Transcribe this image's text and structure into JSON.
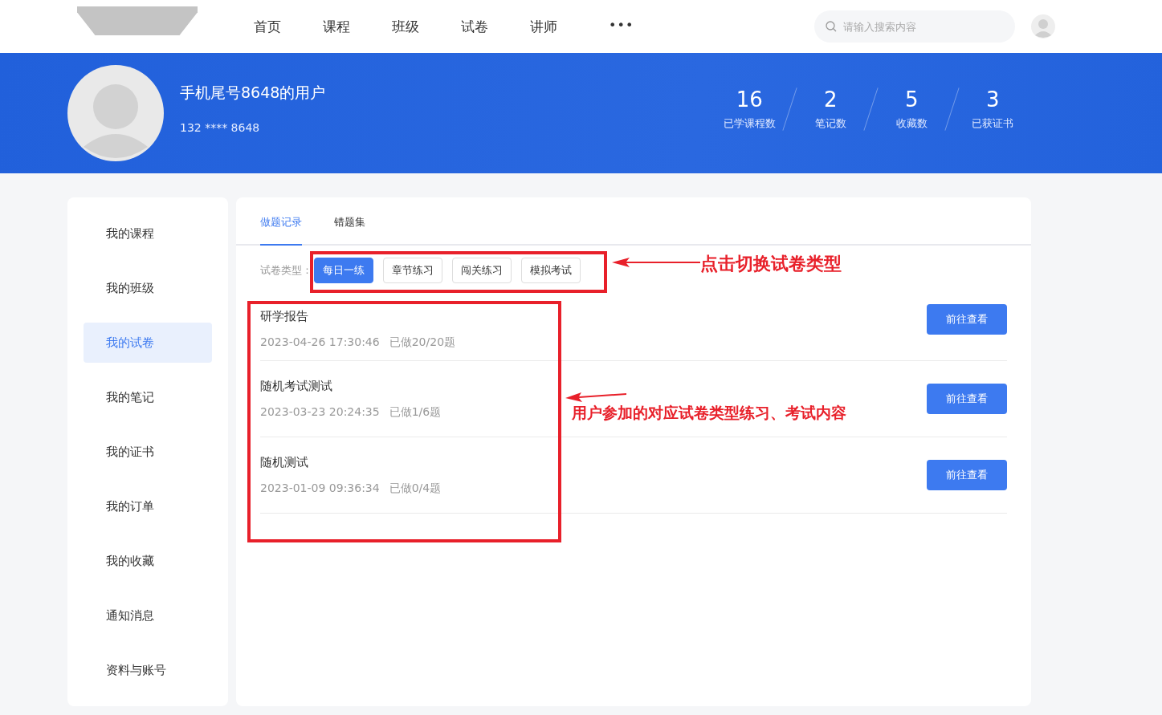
{
  "nav": {
    "items": [
      "首页",
      "课程",
      "班级",
      "试卷",
      "讲师"
    ],
    "more": "•••",
    "search": {
      "placeholder": "请输入搜索内容"
    }
  },
  "profile": {
    "name": "手机尾号8648的用户",
    "phone": "132 **** 8648",
    "stats": [
      {
        "value": "16",
        "label": "已学课程数"
      },
      {
        "value": "2",
        "label": "笔记数"
      },
      {
        "value": "5",
        "label": "收藏数"
      },
      {
        "value": "3",
        "label": "已获证书"
      }
    ]
  },
  "sidebar": {
    "items": [
      {
        "label": "我的课程",
        "selected": false
      },
      {
        "label": "我的班级",
        "selected": false
      },
      {
        "label": "我的试卷",
        "selected": true
      },
      {
        "label": "我的笔记",
        "selected": false
      },
      {
        "label": "我的证书",
        "selected": false
      },
      {
        "label": "我的订单",
        "selected": false
      },
      {
        "label": "我的收藏",
        "selected": false
      },
      {
        "label": "通知消息",
        "selected": false
      },
      {
        "label": "资料与账号",
        "selected": false
      }
    ]
  },
  "tabs": [
    {
      "label": "做题记录",
      "selected": true
    },
    {
      "label": "错题集",
      "selected": false
    }
  ],
  "filter": {
    "label": "试卷类型：",
    "options": [
      {
        "label": "每日一练",
        "selected": true
      },
      {
        "label": "章节练习",
        "selected": false
      },
      {
        "label": "闯关练习",
        "selected": false
      },
      {
        "label": "模拟考试",
        "selected": false
      }
    ]
  },
  "records": [
    {
      "title": "研学报告",
      "time": "2023-04-26 17:30:46",
      "progress": "已做20/20题",
      "action": "前往查看"
    },
    {
      "title": "随机考试测试",
      "time": "2023-03-23 20:24:35",
      "progress": "已做1/6题",
      "action": "前往查看"
    },
    {
      "title": "随机测试",
      "time": "2023-01-09 09:36:34",
      "progress": "已做0/4题",
      "action": "前往查看"
    }
  ],
  "annotations": [
    "点击切换试卷类型",
    "用户参加的对应试卷类型练习、考试内容"
  ]
}
